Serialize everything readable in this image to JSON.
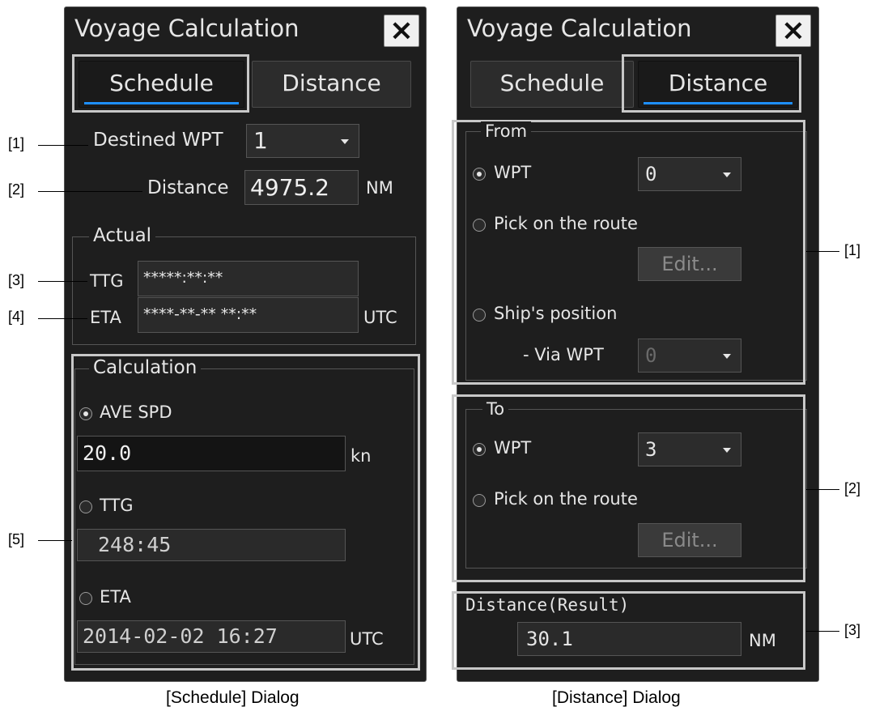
{
  "schedule_dialog": {
    "title": "Voyage Calculation",
    "close_icon": "×",
    "tabs": {
      "schedule": "Schedule",
      "distance": "Distance"
    },
    "destined_wpt_label": "Destined WPT",
    "destined_wpt_value": "1",
    "distance_label": "Distance",
    "distance_value": "4975.2",
    "distance_unit": "NM",
    "actual": {
      "legend": "Actual",
      "ttg_label": "TTG",
      "ttg_value": "*****:**:**",
      "eta_label": "ETA",
      "eta_value": "****-**-** **:**",
      "eta_unit": "UTC"
    },
    "calculation": {
      "legend": "Calculation",
      "ave_spd_label": "AVE SPD",
      "ave_spd_value": "20.0",
      "ave_spd_unit": "kn",
      "ttg_label": "TTG",
      "ttg_value": "248:45",
      "eta_label": "ETA",
      "eta_value": "2014-02-02 16:27",
      "eta_unit": "UTC"
    },
    "caption": "[Schedule] Dialog"
  },
  "distance_dialog": {
    "title": "Voyage Calculation",
    "close_icon": "×",
    "tabs": {
      "schedule": "Schedule",
      "distance": "Distance"
    },
    "from": {
      "legend": "From",
      "wpt_label": "WPT",
      "wpt_value": "0",
      "pick_label": "Pick on the route",
      "edit_label": "Edit...",
      "ship_label": "Ship's position",
      "via_label": "- Via WPT",
      "via_value": "0"
    },
    "to": {
      "legend": "To",
      "wpt_label": "WPT",
      "wpt_value": "3",
      "pick_label": "Pick on the route",
      "edit_label": "Edit..."
    },
    "result_label": "Distance(Result)",
    "result_value": "30.1",
    "result_unit": "NM",
    "caption": "[Distance] Dialog"
  },
  "annotations": {
    "left": [
      "[1]",
      "[2]",
      "[3]",
      "[4]",
      "[5]"
    ],
    "right": [
      "[1]",
      "[2]",
      "[3]"
    ]
  }
}
